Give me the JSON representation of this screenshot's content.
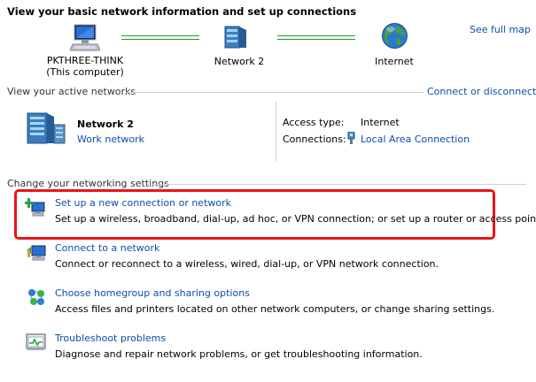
{
  "header": {
    "title": "View your basic network information and set up connections",
    "see_full_map": "See full map"
  },
  "map": {
    "computer_name": "PKTHREE-THINK",
    "computer_sub": "(This computer)",
    "network_name": "Network  2",
    "internet_label": "Internet"
  },
  "active": {
    "section_label": "View your active networks",
    "connect_disconnect": "Connect or disconnect",
    "network_name": "Network  2",
    "network_type": "Work network",
    "access_type_label": "Access type:",
    "access_type_value": "Internet",
    "connections_label": "Connections:",
    "connections_value": "Local Area Connection"
  },
  "settings": {
    "section_label": "Change your networking settings",
    "items": [
      {
        "title": "Set up a new connection or network",
        "desc": "Set up a wireless, broadband, dial-up, ad hoc, or VPN connection; or set up a router or access point."
      },
      {
        "title": "Connect to a network",
        "desc": "Connect or reconnect to a wireless, wired, dial-up, or VPN network connection."
      },
      {
        "title": "Choose homegroup and sharing options",
        "desc": "Access files and printers located on other network computers, or change sharing settings."
      },
      {
        "title": "Troubleshoot problems",
        "desc": "Diagnose and repair network problems, or get troubleshooting information."
      }
    ]
  },
  "colors": {
    "link": "#0b4fa8",
    "highlight": "#e8141b",
    "connector": "#1f9a1f"
  }
}
